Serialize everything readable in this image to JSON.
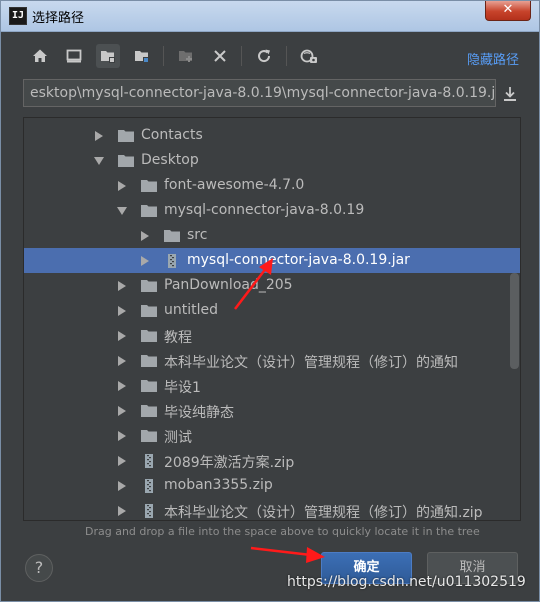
{
  "window": {
    "title": "选择路径",
    "app_icon_text": "IJ",
    "close_symbol": "✕"
  },
  "toolbar": {
    "buttons": [
      {
        "name": "home-icon"
      },
      {
        "name": "desktop-icon"
      },
      {
        "name": "project-folder-icon"
      },
      {
        "name": "module-folder-icon"
      },
      {
        "name": "new-folder-icon"
      },
      {
        "name": "delete-icon"
      },
      {
        "name": "refresh-icon"
      },
      {
        "name": "show-hidden-icon"
      }
    ],
    "hide_path_label": "隐藏路径"
  },
  "path_field": {
    "value": "esktop\\mysql-connector-java-8.0.19\\mysql-connector-java-8.0.19.jar"
  },
  "tree": {
    "rows": [
      {
        "label": "Contacts",
        "type": "folder",
        "expanded": false,
        "depth": 0
      },
      {
        "label": "Desktop",
        "type": "folder",
        "expanded": true,
        "depth": 0
      },
      {
        "label": "font-awesome-4.7.0",
        "type": "folder",
        "expanded": false,
        "depth": 1
      },
      {
        "label": "mysql-connector-java-8.0.19",
        "type": "folder",
        "expanded": true,
        "depth": 1
      },
      {
        "label": "src",
        "type": "folder",
        "expanded": false,
        "depth": 2
      },
      {
        "label": "mysql-connector-java-8.0.19.jar",
        "type": "archive",
        "expanded": false,
        "depth": 2,
        "selected": true
      },
      {
        "label": "PanDownload_205",
        "type": "folder",
        "expanded": false,
        "depth": 1
      },
      {
        "label": "untitled",
        "type": "folder",
        "expanded": false,
        "depth": 1
      },
      {
        "label": "教程",
        "type": "folder",
        "expanded": false,
        "depth": 1
      },
      {
        "label": "本科毕业论文（设计）管理规程（修订）的通知",
        "type": "folder",
        "expanded": false,
        "depth": 1
      },
      {
        "label": "毕设1",
        "type": "folder",
        "expanded": false,
        "depth": 1
      },
      {
        "label": "毕设纯静态",
        "type": "folder",
        "expanded": false,
        "depth": 1
      },
      {
        "label": "测试",
        "type": "folder",
        "expanded": false,
        "depth": 1
      },
      {
        "label": "2089年激活方案.zip",
        "type": "archive",
        "expanded": false,
        "depth": 1
      },
      {
        "label": "moban3355.zip",
        "type": "archive",
        "expanded": false,
        "depth": 1
      },
      {
        "label": "本科毕业论文（设计）管理规程（修订）的通知.zip",
        "type": "archive",
        "expanded": false,
        "depth": 1
      }
    ]
  },
  "hint": "Drag and drop a file into the space above to quickly locate it in the tree",
  "buttons": {
    "help": "?",
    "ok": "确定",
    "cancel": "取消"
  },
  "watermark": "https://blog.csdn.net/u011302519",
  "colors": {
    "background": "#3c3f41",
    "selection": "#4b6eaf",
    "link": "#589df6",
    "annotation_arrow": "#ff1a1a"
  }
}
